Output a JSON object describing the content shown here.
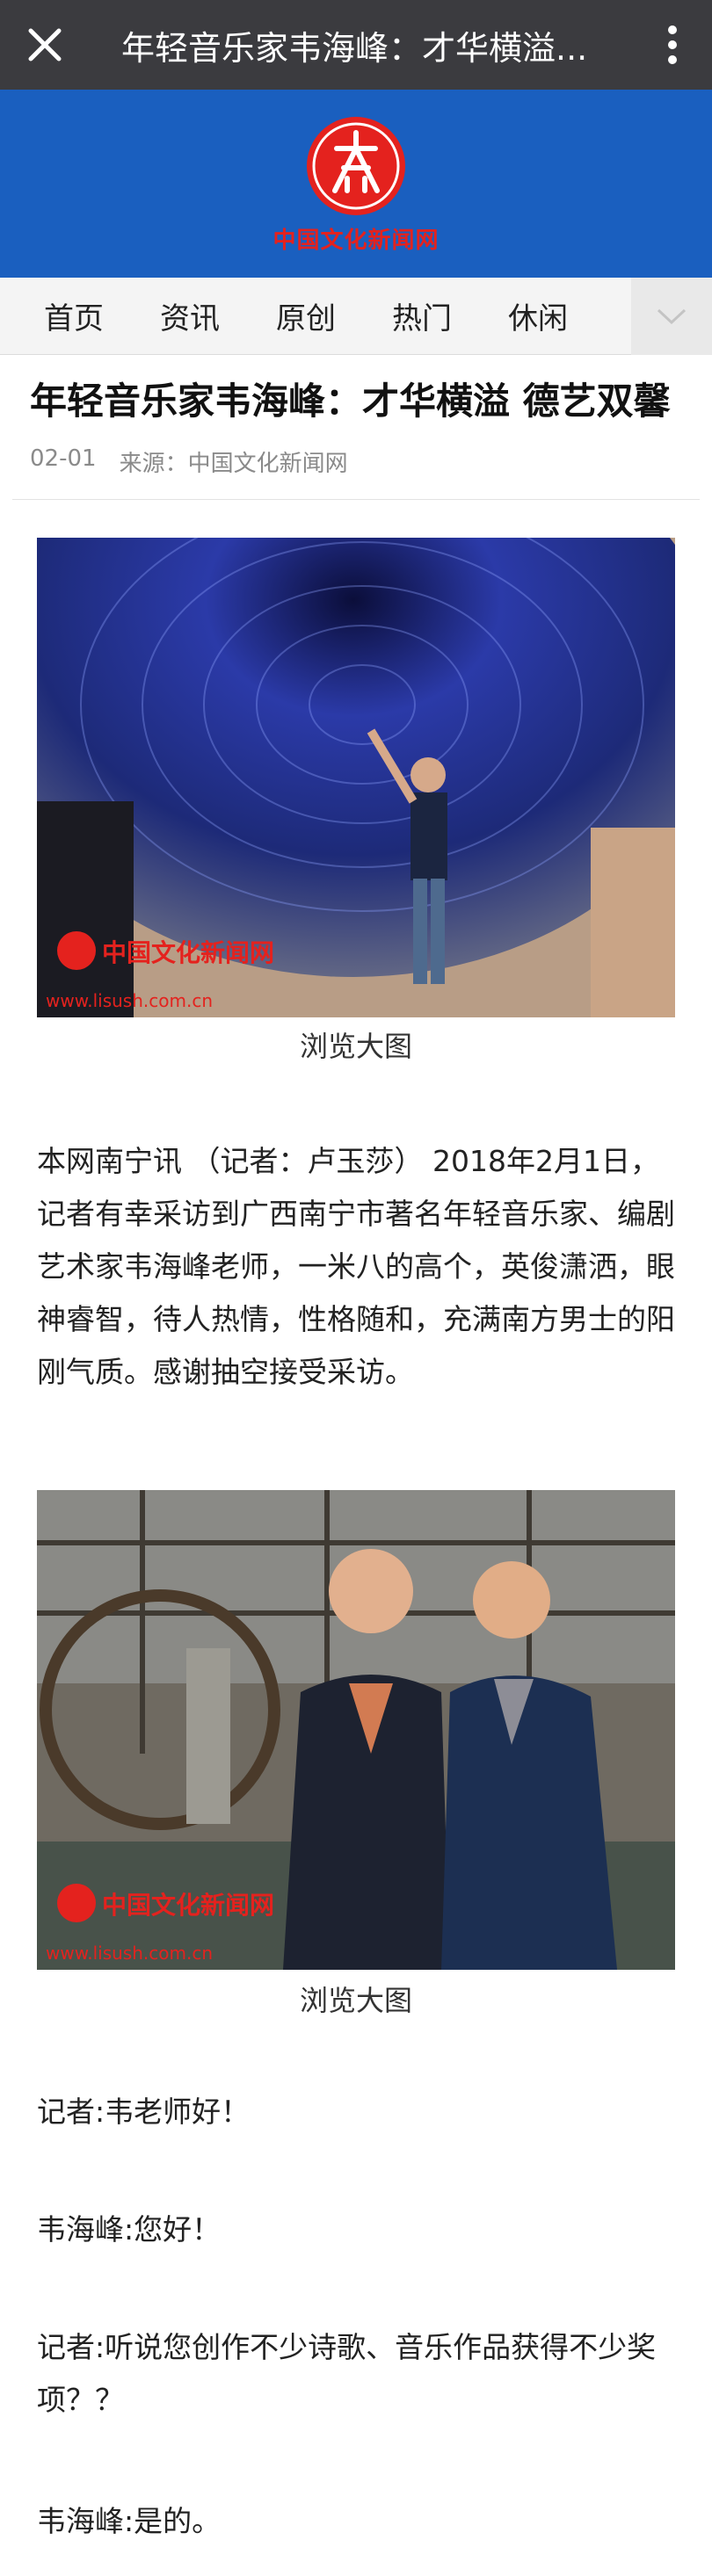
{
  "window": {
    "title": "年轻音乐家韦海峰：才华横溢...",
    "close_icon": "close-icon",
    "more_icon": "more-vertical-icon"
  },
  "brand": {
    "logo_text": "中国文化新闻网",
    "logo_color": "#e4221e",
    "header_bg": "#1a5fbf"
  },
  "nav": {
    "items": [
      {
        "label": "首页"
      },
      {
        "label": "资讯"
      },
      {
        "label": "原创"
      },
      {
        "label": "热门"
      },
      {
        "label": "休闲"
      }
    ],
    "dropdown_icon": "chevron-down-icon"
  },
  "article": {
    "headline": "年轻音乐家韦海峰：才华横溢 德艺双馨",
    "date": "02-01",
    "source": "来源：中国文化新闻网",
    "images": [
      {
        "caption": "浏览大图",
        "watermark_logo": "中国文化新闻网",
        "watermark_url": "www.lisush.com.cn"
      },
      {
        "caption": "浏览大图",
        "watermark_logo": "中国文化新闻网",
        "watermark_url": "www.lisush.com.cn"
      }
    ],
    "intro": "本网南宁讯 （记者：卢玉莎） 2018年2月1日，记者有幸采访到广西南宁市著名年轻音乐家、编剧艺术家韦海峰老师，一米八的高个，英俊潇洒，眼神睿智，待人热情，性格随和，充满南方男士的阳刚气质。感谢抽空接受采访。",
    "dialogue": [
      "记者:韦老师好！",
      "韦海峰:您好！",
      "记者:听说您创作不少诗歌、音乐作品获得不少奖项？？",
      "韦海峰:是的。"
    ]
  }
}
